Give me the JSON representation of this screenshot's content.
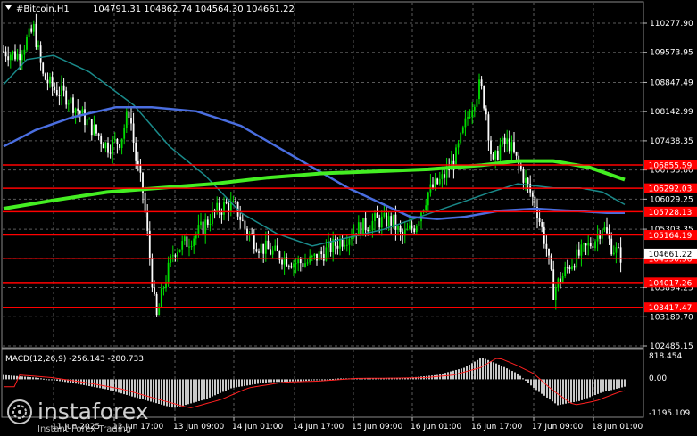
{
  "header": {
    "symbol": "#Bitcoin,H1",
    "ohlc": "104791.31 104862.74 104564.30 104661.22"
  },
  "macd": {
    "title": "MACD(12,26,9) -256.143 -280.733",
    "scale_top": "818.454",
    "scale_mid": "0.00",
    "scale_bottom": "-1195.109"
  },
  "price_axis": {
    "ticks": [
      "110277.90",
      "109573.95",
      "108847.49",
      "108142.99",
      "107438.35",
      "106733.80",
      "106029.25",
      "105303.35",
      "104598.80",
      "103894.25",
      "103189.70",
      "102485.15"
    ],
    "current_price": "104661.22"
  },
  "levels": [
    {
      "value": 106855.59,
      "label": "106855.59"
    },
    {
      "value": 106292.03,
      "label": "106292.03"
    },
    {
      "value": 105728.13,
      "label": "105728.13"
    },
    {
      "value": 105164.19,
      "label": "105164.19"
    },
    {
      "value": 104590.36,
      "label": "104590.36"
    },
    {
      "value": 104017.26,
      "label": "104017.26"
    },
    {
      "value": 103417.47,
      "label": "103417.47"
    }
  ],
  "time_axis": {
    "labels": [
      "11 Jun 2025",
      "12 Jun 17:00",
      "13 Jun 09:00",
      "14 Jun 01:00",
      "14 Jun 17:00",
      "15 Jun 09:00",
      "16 Jun 01:00",
      "16 Jun 17:00",
      "17 Jun 09:00",
      "18 Jun 01:00"
    ]
  },
  "watermark": {
    "brand": "instaforex",
    "tagline": "Instant Forex Trading"
  },
  "colors": {
    "background": "#000000",
    "grid": "#5a5a5a",
    "bull": "#00e000",
    "bear": "#ffffff",
    "ma_fast": "#1a8a8a",
    "ma_mid": "#4a6ee0",
    "ma_slow": "#44ee22",
    "level_line": "#ff0000",
    "macd_hist": "#c8c8c8",
    "macd_signal": "#ff2020"
  }
}
